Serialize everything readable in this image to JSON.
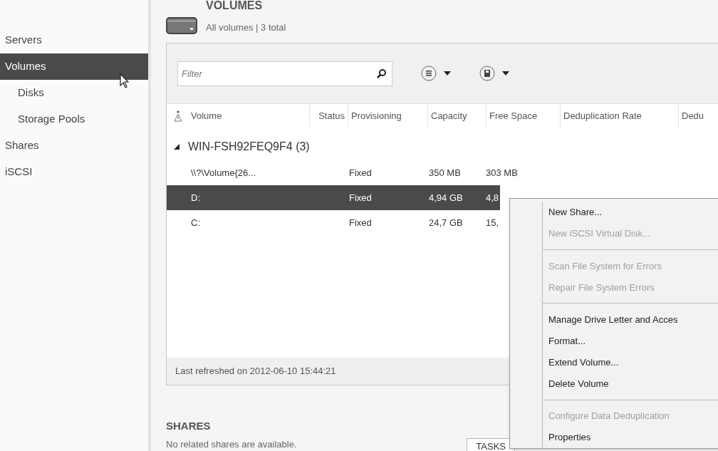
{
  "sidebar": {
    "items": [
      {
        "label": "Servers",
        "selected": false
      },
      {
        "label": "Volumes",
        "selected": true,
        "children": [
          {
            "label": "Disks",
            "selected": false
          },
          {
            "label": "Storage Pools",
            "selected": false
          }
        ]
      },
      {
        "label": "Shares",
        "selected": false
      },
      {
        "label": "iSCSI",
        "selected": false
      }
    ]
  },
  "volumes": {
    "title": "VOLUMES",
    "subtitle": "All volumes | 3 total",
    "filter": {
      "placeholder": "Filter"
    },
    "columns": [
      "Volume",
      "Status",
      "Provisioning",
      "Capacity",
      "Free Space",
      "Deduplication Rate",
      "Dedu"
    ],
    "group": {
      "label": "WIN-FSH92FEQ9F4 (3)",
      "expanded": true
    },
    "rows": [
      {
        "cells": [
          "\\\\?\\Volume{26...",
          "",
          "Fixed",
          "350 MB",
          "303 MB"
        ],
        "selected": false
      },
      {
        "cells": [
          "D:",
          "",
          "Fixed",
          "4,94 GB",
          "4,8"
        ],
        "selected": true
      },
      {
        "cells": [
          "C:",
          "",
          "Fixed",
          "24,7 GB",
          "15,"
        ],
        "selected": false
      }
    ],
    "status": "Last refreshed on 2012-06-10 15:44:21"
  },
  "shares": {
    "title": "SHARES",
    "message": "No related shares are available.",
    "tasks_button": "TASKS"
  },
  "context_menu": {
    "groups": [
      [
        {
          "label": "New Share...",
          "disabled": false
        },
        {
          "label": "New iSCSI Virtual Disk...",
          "disabled": true
        }
      ],
      [
        {
          "label": "Scan File System for Errors",
          "disabled": true
        },
        {
          "label": "Repair File System Errors",
          "disabled": true
        }
      ],
      [
        {
          "label": "Manage Drive Letter and Acces",
          "disabled": false
        },
        {
          "label": "Format...",
          "disabled": false
        },
        {
          "label": "Extend Volume...",
          "disabled": false
        },
        {
          "label": "Delete Volume",
          "disabled": false
        }
      ],
      [
        {
          "label": "Configure Data Deduplication",
          "disabled": true
        },
        {
          "label": "Properties",
          "disabled": false
        }
      ]
    ]
  }
}
